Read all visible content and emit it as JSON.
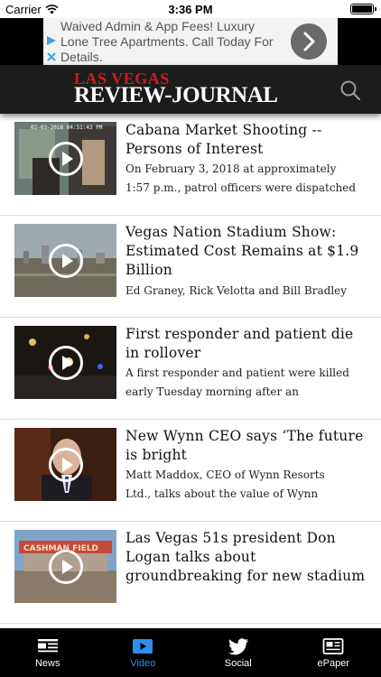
{
  "status_bar": {
    "carrier": "Carrier",
    "time": "3:36 PM"
  },
  "ad": {
    "text": "Waived Admin & App Fees! Luxury Lone Tree Apartments. Call Today For Details."
  },
  "masthead": {
    "logo_top": "LAS VEGAS",
    "logo_bottom": "REVIEW-JOURNAL"
  },
  "stories": [
    {
      "title": "Cabana Market Shooting -- Persons of Interest",
      "summary_lines": [
        "On February 3, 2018 at approximately",
        "1:57 p.m., patrol officers were dispatched"
      ],
      "timestamp": "02-03-2018 04:51:43 PM"
    },
    {
      "title": "Vegas Nation Stadium Show: Estimated Cost Remains at $1.9 Billion",
      "summary_lines": [
        "Ed Graney, Rick Velotta and Bill Bradley"
      ]
    },
    {
      "title": "First responder and patient die in rollover",
      "summary_lines": [
        "A first responder and patient were killed",
        "early Tuesday morning after an"
      ]
    },
    {
      "title": "New Wynn CEO says ‘The future is bright",
      "summary_lines": [
        "Matt Maddox, CEO of Wynn Resorts",
        "Ltd., talks about the value of Wynn"
      ]
    },
    {
      "title": "Las Vegas 51s president Don Logan talks about groundbreaking for new stadium",
      "summary_lines": [],
      "sign_text": "CASHMAN FIELD"
    }
  ],
  "tabs": [
    {
      "label": "News",
      "icon": "news-icon",
      "active": false
    },
    {
      "label": "Video",
      "icon": "video-icon",
      "active": true
    },
    {
      "label": "Social",
      "icon": "twitter-bird-icon",
      "active": false
    },
    {
      "label": "ePaper",
      "icon": "epaper-icon",
      "active": false
    }
  ],
  "colors": {
    "accent": "#2f8df0",
    "brand_red": "#d11a1a",
    "masthead_bg": "#1c1c1c",
    "tabbar_bg": "#000000"
  }
}
